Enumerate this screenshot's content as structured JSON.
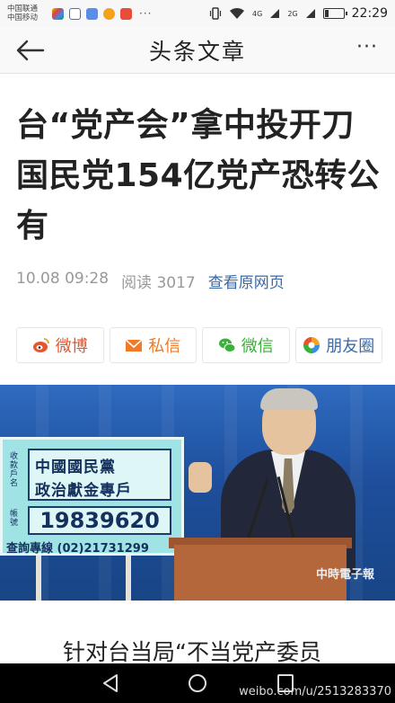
{
  "status_bar": {
    "carrier_1": "中国联通",
    "carrier_2": "中国移动",
    "app_icons": [
      "weibo-icon",
      "gallery-icon",
      "baidu-icon",
      "notes-icon",
      "eye-icon",
      "app-icon"
    ],
    "dots": "···",
    "signal_1": "4G",
    "signal_2": "2G",
    "battery_level": 0.2,
    "time": "22:29"
  },
  "nav": {
    "title": "头条文章",
    "more": "···"
  },
  "article": {
    "title": "台“党产会”拿中投开刀国民党154亿党产恐转公有",
    "date": "10.08 09:28",
    "reads": "阅读 3017",
    "view_original": "查看原网页",
    "body_snippet": "针对台当局“不当党产委员"
  },
  "share": [
    {
      "label": "微博",
      "icon": "weibo-icon",
      "color": "#e8552b"
    },
    {
      "label": "私信",
      "icon": "mail-icon",
      "color": "#f07a26"
    },
    {
      "label": "微信",
      "icon": "wechat-icon",
      "color": "#3ab239"
    },
    {
      "label": "朋友圈",
      "icon": "moments-icon",
      "color": "#3a6aa8"
    }
  ],
  "photo": {
    "sign_line_1": "中國國民黨",
    "sign_line_2": "政治獻金專戶",
    "sign_label_1": "收款戶名",
    "sign_label_2": "帳號",
    "sign_account": "19839620",
    "sign_hotline": "查詢專線 (02)21731299",
    "watermark": "中時電子報"
  },
  "watermark": "weibo.com/u/2513283370",
  "colors": {
    "link": "#3a6aa8",
    "meta": "#999999",
    "nav_bg": "#f9f9f9"
  }
}
